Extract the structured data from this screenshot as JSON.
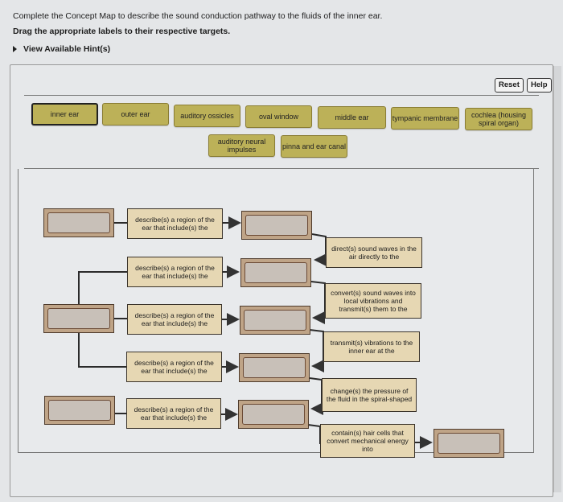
{
  "instructions": {
    "line1": "Complete the Concept Map to describe the sound conduction pathway to the fluids of the inner ear.",
    "line2": "Drag the appropriate labels to their respective targets.",
    "hint_link": "View Available Hint(s)"
  },
  "toolbar": {
    "reset_label": "Reset",
    "help_label": "Help"
  },
  "label_bank": [
    {
      "text": "inner ear",
      "selected": true
    },
    {
      "text": "outer ear",
      "selected": false
    },
    {
      "text": "auditory ossicles",
      "selected": false
    },
    {
      "text": "oval window",
      "selected": false
    },
    {
      "text": "middle ear",
      "selected": false
    },
    {
      "text": "tympanic membrane",
      "selected": false
    },
    {
      "text": "cochlea (housing spiral organ)",
      "selected": false
    },
    {
      "text": "auditory neural impulses",
      "selected": false
    },
    {
      "text": "pinna and ear canal",
      "selected": false
    }
  ],
  "concept_map": {
    "left_links": [
      "describe(s) a region of the ear that include(s) the",
      "describe(s) a region of the ear that include(s) the",
      "describe(s) a region of the ear that include(s) the",
      "describe(s) a region of the ear that include(s) the",
      "describe(s) a region of the ear that include(s) the"
    ],
    "right_links": [
      "direct(s) sound waves in the air directly to the",
      "convert(s) sound waves into local vibrations and transmit(s) them to the",
      "transmit(s) vibrations to the inner ear at the",
      "change(s) the pressure of the fluid in the spiral-shaped",
      "contain(s) hair cells that convert mechanical energy into"
    ],
    "target_count": 9,
    "colors": {
      "label_chip": "#bcb158",
      "link_box": "#e6d7b3",
      "target_outer": "#bfa487",
      "target_inner": "#c8c0b8"
    }
  }
}
